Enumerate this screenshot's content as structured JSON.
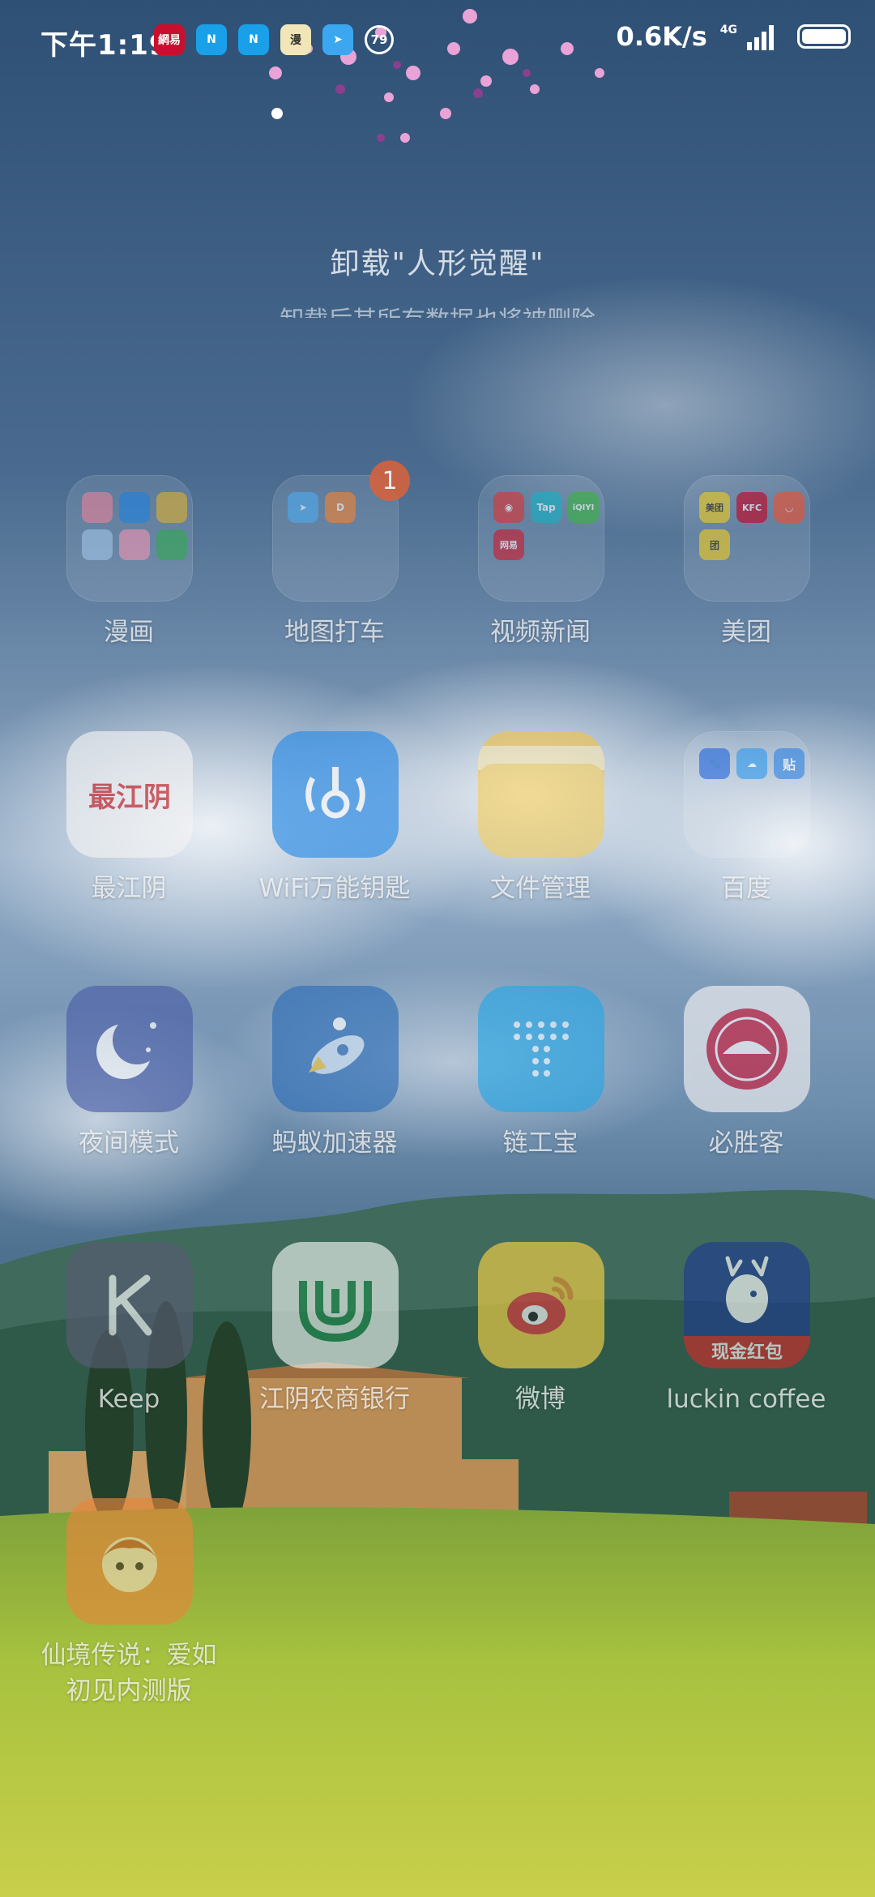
{
  "status_bar": {
    "time": "下午1:19",
    "network_speed": "0.6K/s",
    "network_type": "4G",
    "notification_icons": [
      "netease-news-icon",
      "n-app-icon",
      "n-app-icon",
      "comic-app-icon",
      "send-app-icon",
      "count-badge-icon"
    ],
    "notification_count": "79"
  },
  "uninstall_hint": {
    "title": "卸载\"人形觉醒\"",
    "subtitle": "卸载后其所有数据也将被删除"
  },
  "apps": [
    {
      "label": "漫画",
      "type": "folder"
    },
    {
      "label": "地图打车",
      "type": "folder",
      "badge": "1"
    },
    {
      "label": "视频新闻",
      "type": "folder"
    },
    {
      "label": "美团",
      "type": "folder"
    },
    {
      "label": "最江阴",
      "type": "app",
      "icon_text": "最江阴"
    },
    {
      "label": "WiFi万能钥匙",
      "type": "app"
    },
    {
      "label": "文件管理",
      "type": "app"
    },
    {
      "label": "百度",
      "type": "folder"
    },
    {
      "label": "夜间模式",
      "type": "app"
    },
    {
      "label": "蚂蚁加速器",
      "type": "app"
    },
    {
      "label": "链工宝",
      "type": "app"
    },
    {
      "label": "必胜客",
      "type": "app"
    },
    {
      "label": "Keep",
      "type": "app"
    },
    {
      "label": "江阴农商银行",
      "type": "app"
    },
    {
      "label": "微博",
      "type": "app"
    },
    {
      "label": "luckin coffee",
      "type": "app",
      "icon_text": "现金红包"
    },
    {
      "label": "仙境传说：爱如初见内测版",
      "type": "app"
    }
  ],
  "folder_contents": {
    "video_news": [
      "Tap",
      "iQIYI",
      "网易"
    ],
    "meituan": [
      "美团",
      "KFC"
    ],
    "baidu": [
      "贴"
    ]
  },
  "colors": {
    "sky_top": "#3b5f86",
    "sky_mid": "#8fa9c4",
    "hills": "#3e6b5a",
    "grass": "#9bbd3c",
    "badge": "#d4623f"
  }
}
